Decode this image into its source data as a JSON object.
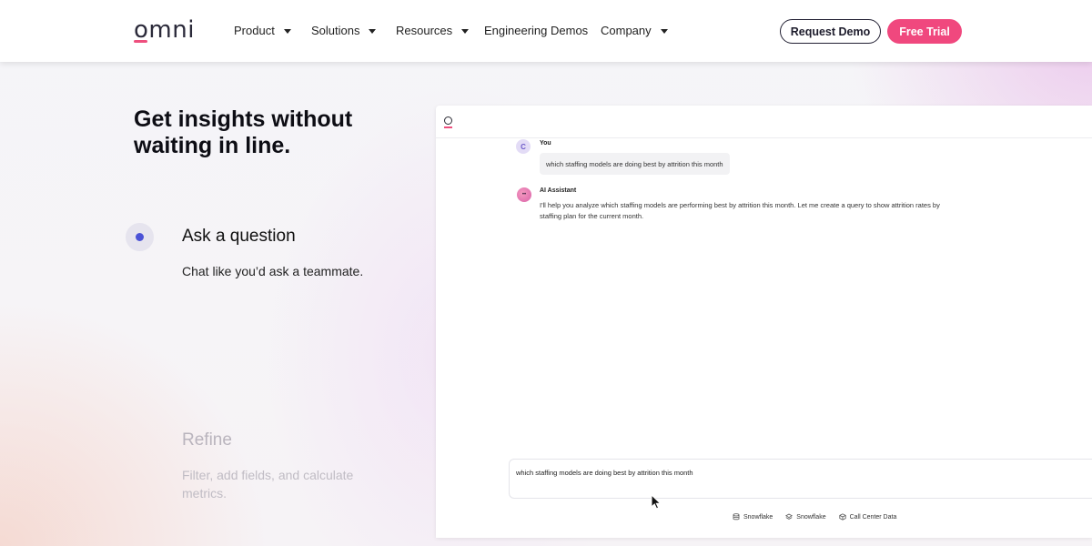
{
  "header": {
    "logo": "omni",
    "nav": [
      {
        "label": "Product",
        "dropdown": true
      },
      {
        "label": "Solutions",
        "dropdown": true
      },
      {
        "label": "Resources",
        "dropdown": true
      },
      {
        "label": "Engineering Demos",
        "dropdown": false
      },
      {
        "label": "Company",
        "dropdown": true
      }
    ],
    "request_demo": "Request Demo",
    "free_trial": "Free Trial"
  },
  "hero": {
    "title": "Get insights without waiting in line."
  },
  "steps": [
    {
      "title": "Ask a question",
      "description": "Chat like you’d ask a teammate.",
      "active": true
    },
    {
      "title": "Refine",
      "description": "Filter, add fields, and calculate metrics.",
      "active": false
    }
  ],
  "chat": {
    "user": {
      "avatar": "C",
      "name": "You",
      "message": "which staffing models are doing best by attrition this month"
    },
    "assistant": {
      "name": "AI Assistant",
      "message": "I'll help you analyze which staffing models are performing best by attrition this month. Let me create a query to show attrition rates by staffing plan for the current month."
    },
    "input_value": "which staffing models are doing best by attrition this month",
    "sources": [
      {
        "icon": "database-icon",
        "label": "Snowflake"
      },
      {
        "icon": "layers-icon",
        "label": "Snowflake"
      },
      {
        "icon": "cube-icon",
        "label": "Call Center Data"
      }
    ]
  },
  "colors": {
    "accent_pink": "#f0487e",
    "accent_blue": "#4b52d6",
    "dark": "#1c1b2b"
  }
}
